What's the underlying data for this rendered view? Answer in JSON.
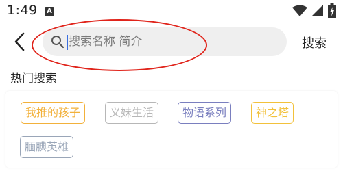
{
  "status_bar": {
    "time": "1:49",
    "notification_icon": "A"
  },
  "search": {
    "placeholder": "搜索名称 简介",
    "button_label": "搜索"
  },
  "hot_search": {
    "title": "热门搜索",
    "tags": [
      {
        "label": "我推的孩子",
        "color": "#f2b13b"
      },
      {
        "label": "义妹生活",
        "color": "#b7b7b7"
      },
      {
        "label": "物语系列",
        "color": "#7a7fbf"
      },
      {
        "label": "神之塔",
        "color": "#f2c13b"
      },
      {
        "label": "腼腆英雄",
        "color": "#9aa6b8"
      }
    ]
  },
  "colors": {
    "annotation": "#e0241b",
    "cursor": "#3a6fe0"
  }
}
